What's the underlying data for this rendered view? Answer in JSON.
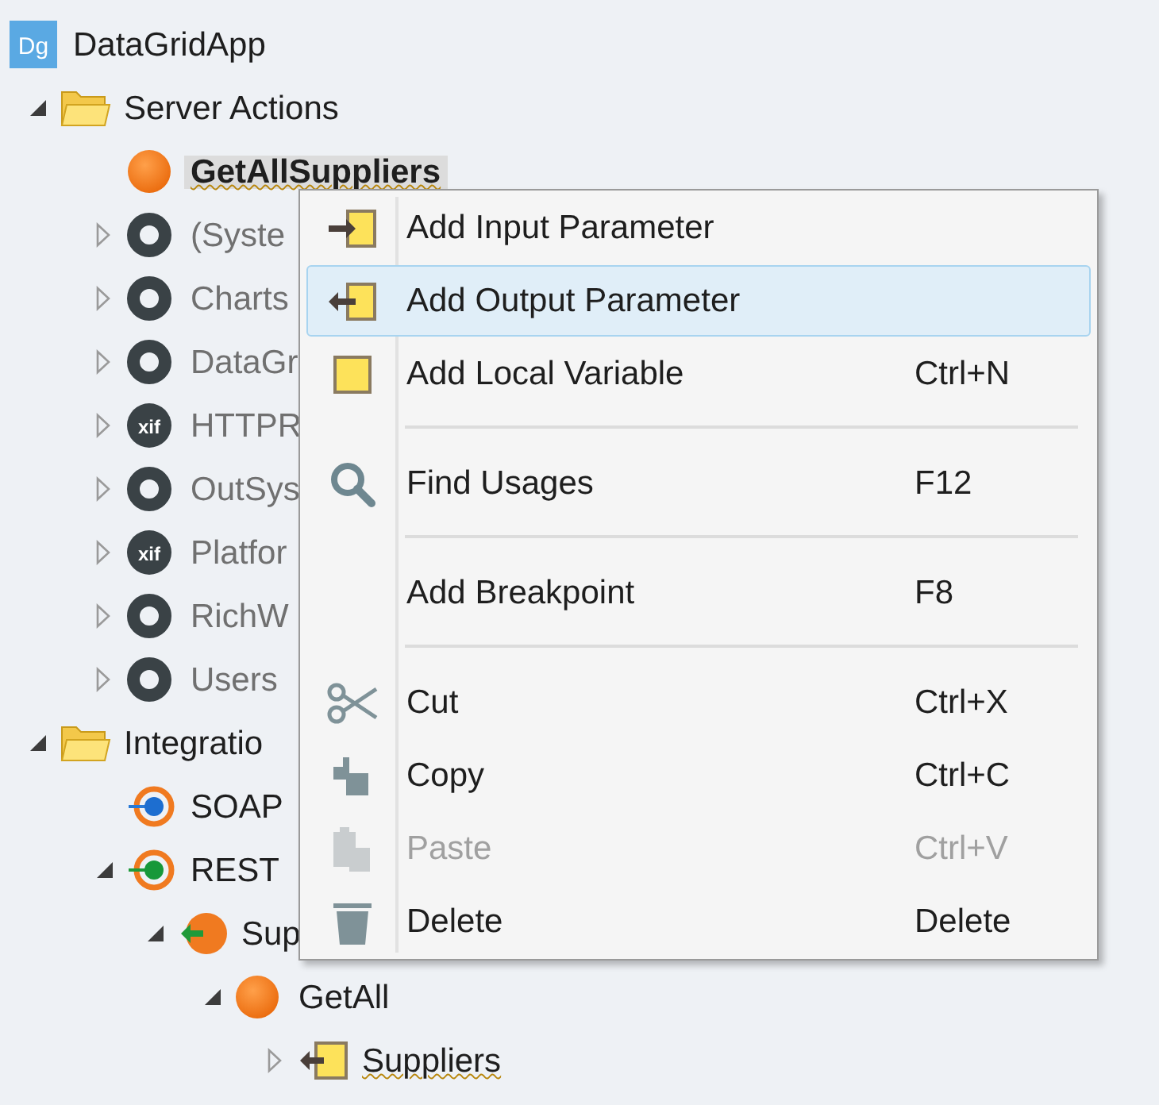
{
  "tree": [
    {
      "label": "DataGridApp",
      "kind": "app",
      "badge": "Dg",
      "children": [
        {
          "label": "Server Actions",
          "kind": "folder",
          "expanded": true,
          "children": [
            {
              "label": "GetAllSuppliers",
              "kind": "action",
              "selected": true,
              "warning": true
            },
            {
              "label": "(Syste",
              "kind": "module",
              "expanded": false,
              "dim": true,
              "selected": false
            },
            {
              "label": "Charts",
              "kind": "module",
              "expanded": false,
              "dim": true,
              "selected": false
            },
            {
              "label": "DataGr",
              "kind": "module",
              "expanded": false,
              "dim": true,
              "selected": false
            },
            {
              "label": "HTTPR",
              "kind": "extension",
              "badge": "xif",
              "expanded": false,
              "dim": true,
              "selected": false
            },
            {
              "label": "OutSys",
              "kind": "module",
              "expanded": false,
              "dim": true,
              "selected": false
            },
            {
              "label": "Platfor",
              "kind": "extension",
              "badge": "xif",
              "expanded": false,
              "dim": true,
              "selected": false
            },
            {
              "label": "RichW",
              "kind": "module",
              "expanded": false,
              "dim": true,
              "selected": false
            },
            {
              "label": "Users",
              "kind": "module",
              "expanded": false,
              "dim": true,
              "selected": false
            }
          ]
        },
        {
          "label": "Integratio",
          "kind": "folder",
          "expanded": true,
          "children": [
            {
              "label": "SOAP",
              "kind": "soap",
              "selected": false
            },
            {
              "label": "REST",
              "kind": "rest",
              "expanded": true,
              "selected": false,
              "children": [
                {
                  "label": "Sup",
                  "kind": "rest-api",
                  "expanded": true,
                  "selected": false,
                  "children": [
                    {
                      "label": "GetAll",
                      "kind": "action",
                      "expanded": true,
                      "selected": false,
                      "children": [
                        {
                          "label": "Suppliers",
                          "kind": "output-param",
                          "expanded": false,
                          "selected": false,
                          "warning": true
                        }
                      ]
                    }
                  ]
                }
              ]
            }
          ]
        }
      ]
    }
  ],
  "context_menu": {
    "items": [
      {
        "kind": "input-param",
        "label": "Add Input Parameter",
        "highlighted": false
      },
      {
        "kind": "output-param",
        "label": "Add Output Parameter",
        "highlighted": true
      },
      {
        "kind": "local-var",
        "label": "Add Local Variable",
        "shortcut": "Ctrl+N",
        "highlighted": false
      },
      {
        "kind": "separator"
      },
      {
        "kind": "search",
        "label": "Find Usages",
        "shortcut": "F12",
        "highlighted": false
      },
      {
        "kind": "separator"
      },
      {
        "kind": "blank",
        "label": "Add Breakpoint",
        "shortcut": "F8",
        "highlighted": false
      },
      {
        "kind": "separator"
      },
      {
        "kind": "cut",
        "label": "Cut",
        "shortcut": "Ctrl+X",
        "highlighted": false
      },
      {
        "kind": "copy",
        "label": "Copy",
        "shortcut": "Ctrl+C",
        "highlighted": false
      },
      {
        "kind": "paste",
        "label": "Paste",
        "shortcut": "Ctrl+V",
        "disabled": true,
        "highlighted": false
      },
      {
        "kind": "delete",
        "label": "Delete",
        "shortcut": "Delete",
        "highlighted": false
      }
    ]
  }
}
